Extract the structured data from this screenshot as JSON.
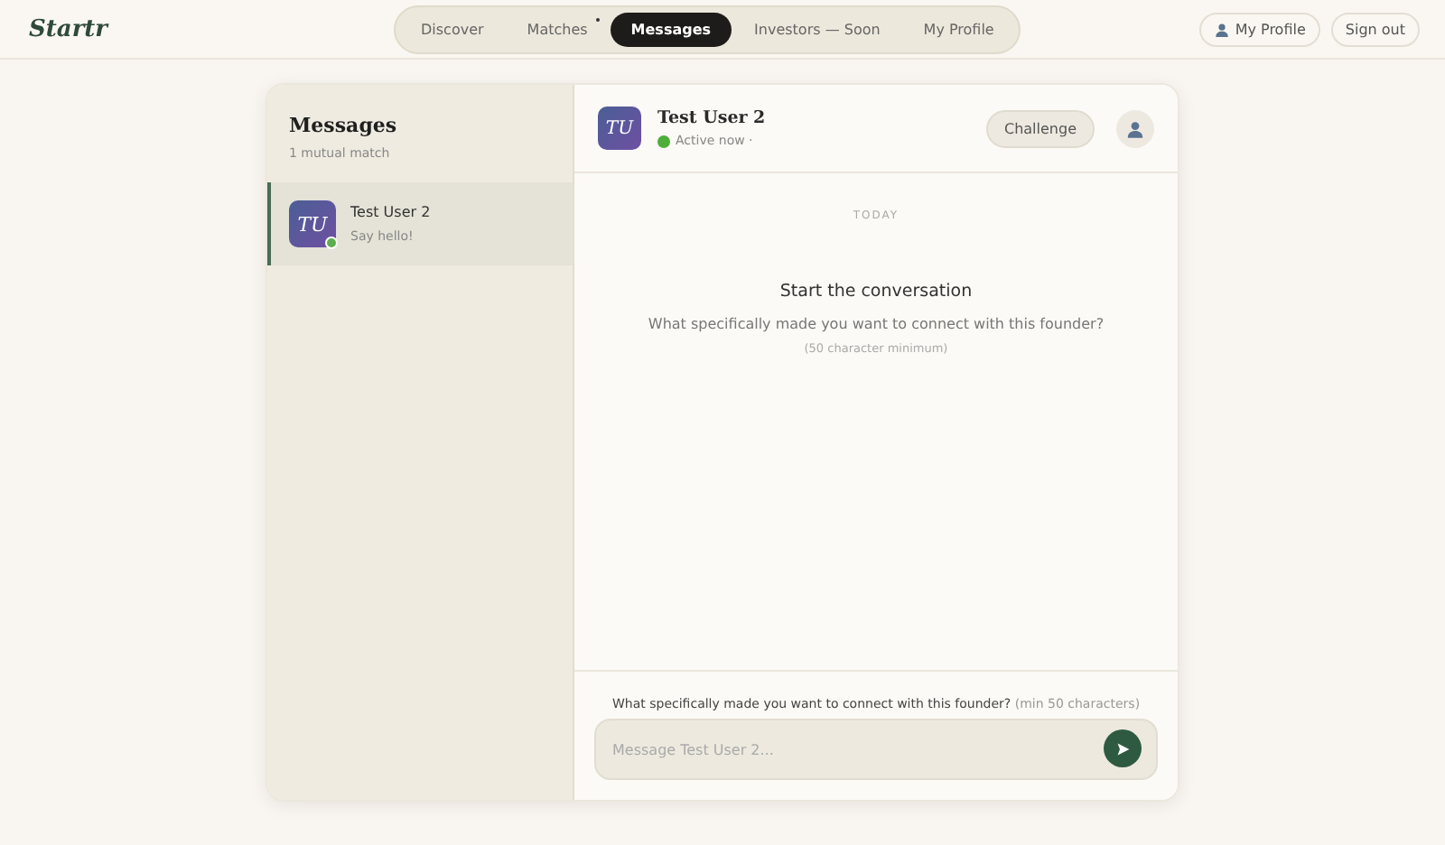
{
  "brand": "Startr",
  "nav": [
    {
      "label": "Discover",
      "selected": false,
      "notify": false
    },
    {
      "label": "Matches",
      "selected": false,
      "notify": true
    },
    {
      "label": "Messages",
      "selected": true,
      "notify": false
    },
    {
      "label": "Investors — Soon",
      "selected": false,
      "notify": false
    },
    {
      "label": "My Profile",
      "selected": false,
      "notify": false
    }
  ],
  "header_actions": [
    {
      "kind": "profile",
      "label": "My Profile"
    },
    {
      "kind": "plain",
      "label": "Sign out"
    }
  ],
  "sidebar": {
    "title": "Messages",
    "subtitle": "1 mutual match",
    "conversations": [
      {
        "initials": "TU",
        "name": "Test User 2",
        "preview": "Say hello!",
        "online": true,
        "selected": true
      }
    ]
  },
  "chat": {
    "initials": "TU",
    "name": "Test User 2",
    "status": "Active now ·",
    "online": true,
    "challenge_button": "Challenge",
    "day_label": "TODAY",
    "empty_title": "Start the conversation",
    "empty_prompt": "What specifically made you want to connect with this founder?",
    "empty_hint": "(50 character minimum)",
    "composer": {
      "prompt": "What specifically made you want to connect with this founder?",
      "hint": "(min 50 characters)",
      "placeholder": "Message Test User 2..."
    }
  }
}
